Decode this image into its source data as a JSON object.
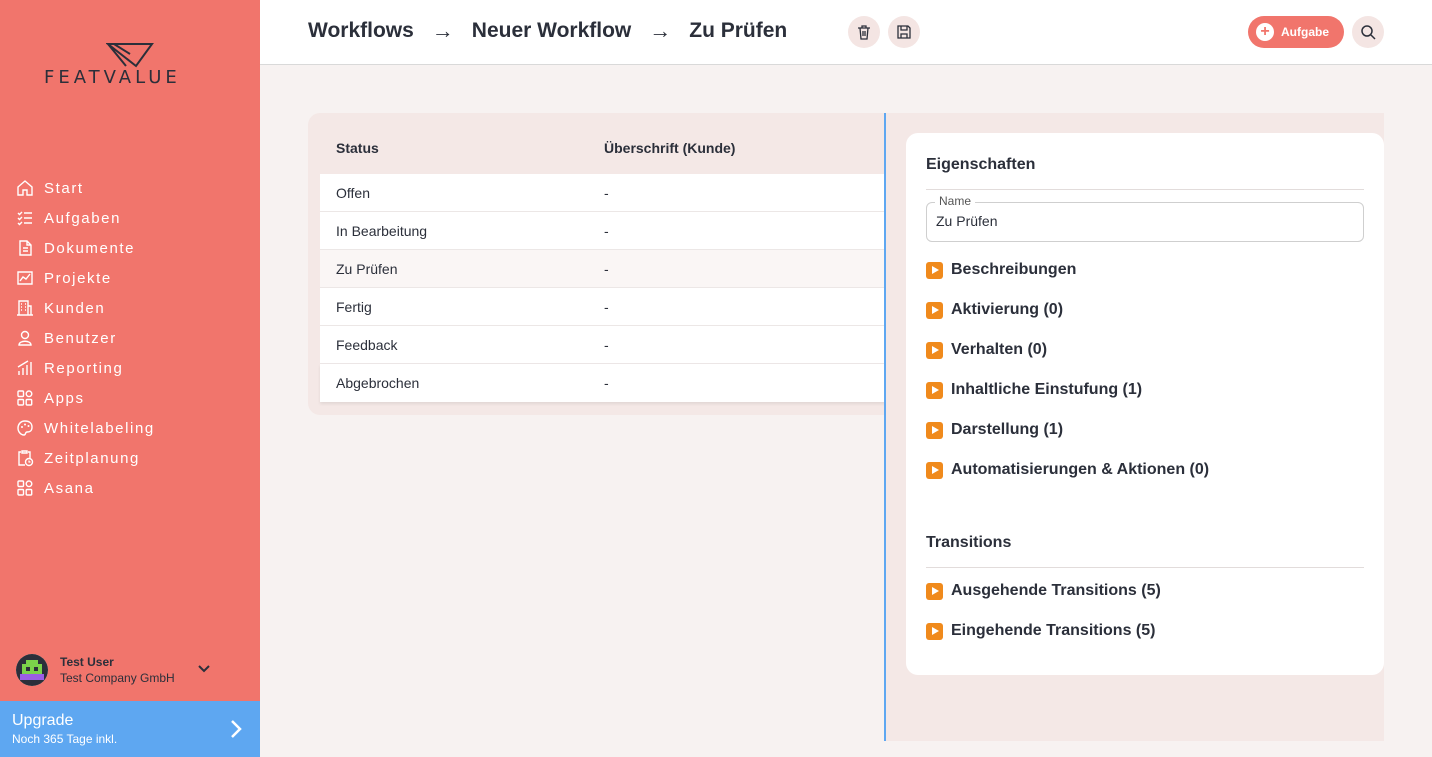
{
  "brand": {
    "name": "FEATVALUE"
  },
  "sidebar": {
    "items": [
      {
        "label": "Start",
        "icon": "home-icon"
      },
      {
        "label": "Aufgaben",
        "icon": "tasks-icon"
      },
      {
        "label": "Dokumente",
        "icon": "documents-icon"
      },
      {
        "label": "Projekte",
        "icon": "projects-icon"
      },
      {
        "label": "Kunden",
        "icon": "building-icon"
      },
      {
        "label": "Benutzer",
        "icon": "user-icon"
      },
      {
        "label": "Reporting",
        "icon": "chart-icon"
      },
      {
        "label": "Apps",
        "icon": "apps-icon"
      },
      {
        "label": "Whitelabeling",
        "icon": "palette-icon"
      },
      {
        "label": "Zeitplanung",
        "icon": "clipboard-clock-icon"
      },
      {
        "label": "Asana",
        "icon": "apps-icon"
      }
    ],
    "user": {
      "name": "Test User",
      "company": "Test Company GmbH"
    },
    "upgrade": {
      "title": "Upgrade",
      "subtitle": "Noch 365 Tage inkl."
    }
  },
  "header": {
    "breadcrumbs": [
      "Workflows",
      "Neuer Workflow",
      "Zu Prüfen"
    ],
    "arrow": "→",
    "add_task_label": "Aufgabe"
  },
  "table": {
    "columns": [
      "Status",
      "Überschrift (Kunde)"
    ],
    "rows": [
      {
        "status": "Offen",
        "heading": "-"
      },
      {
        "status": "In Bearbeitung",
        "heading": "-"
      },
      {
        "status": "Zu Prüfen",
        "heading": "-"
      },
      {
        "status": "Fertig",
        "heading": "-"
      },
      {
        "status": "Feedback",
        "heading": "-"
      },
      {
        "status": "Abgebrochen",
        "heading": "-"
      }
    ],
    "selected_index": 2
  },
  "properties": {
    "title": "Eigenschaften",
    "name_label": "Name",
    "name_value": "Zu Prüfen",
    "sections": [
      "Beschreibungen",
      "Aktivierung (0)",
      "Verhalten (0)",
      "Inhaltliche Einstufung (1)",
      "Darstellung (1)",
      "Automatisierungen & Aktionen (0)"
    ]
  },
  "transitions": {
    "title": "Transitions",
    "sections": [
      "Ausgehende Transitions (5)",
      "Eingehende Transitions (5)"
    ]
  },
  "colors": {
    "sidebar": "#f1756c",
    "accent_blue": "#5ea7f1",
    "play_orange": "#f08a1c"
  }
}
